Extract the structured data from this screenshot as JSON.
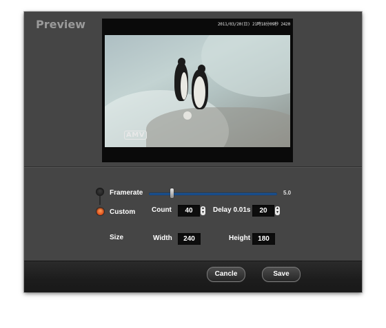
{
  "window": {
    "title": "Preview"
  },
  "video": {
    "overlay_timestamp": "2011/03/20(日) 21時18分09秒 2420",
    "watermark": "AMV"
  },
  "mode": {
    "framerate_label": "Framerate",
    "custom_label": "Custom",
    "selected": "Custom"
  },
  "framerate": {
    "value_text": "5.0",
    "slider_fraction": 0.18
  },
  "custom": {
    "count_label": "Count",
    "count_value": "40",
    "delay_label": "Delay 0.01s",
    "delay_value": "20"
  },
  "size": {
    "label": "Size",
    "width_label": "Width",
    "width_value": "240",
    "height_label": "Height",
    "height_value": "180"
  },
  "buttons": {
    "cancel": "Cancle",
    "save": "Save"
  },
  "colors": {
    "dialog_bg": "#454545",
    "accent_blue": "#2d6fb6",
    "radio_on": "#e0501a"
  }
}
